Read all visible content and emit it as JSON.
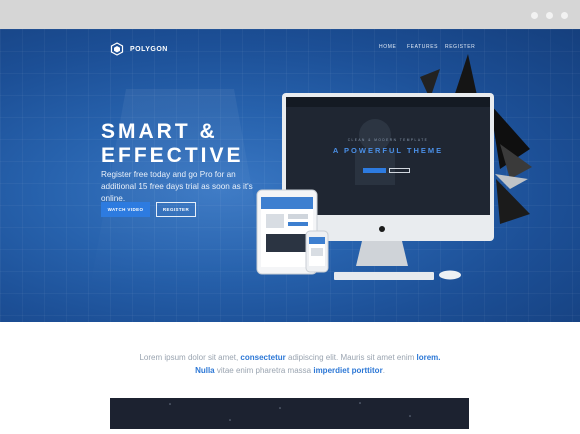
{
  "brand": {
    "name": "POLYGON"
  },
  "nav": {
    "home": "HOME",
    "features": "FEATURES",
    "register": "REGISTER"
  },
  "hero": {
    "headline_line1": "SMART &",
    "headline_line2": "EFFECTIVE",
    "subtext": "Register free today and go Pro for an additional 15 free days trial as soon as it's online.",
    "cta_primary": "WATCH VIDEO",
    "cta_secondary": "REGISTER"
  },
  "monitor": {
    "eyebrow": "CLEAN & MODERN TEMPLATE",
    "title": "A POWERFUL THEME"
  },
  "intro": {
    "part1": "Lorem ipsum dolor sit amet, ",
    "hl1": "consectetur",
    "part2": " adipiscing elit. Mauris sit amet enim ",
    "hl2": "lorem. Nulla",
    "part3": " vitae enim pharetra massa ",
    "hl3": "imperdiet porttitor",
    "part4": "."
  },
  "colors": {
    "hero_blue": "#2762ad",
    "accent": "#2d7be0",
    "chrome": "#d6d6d6",
    "dark": "#1c2230"
  }
}
